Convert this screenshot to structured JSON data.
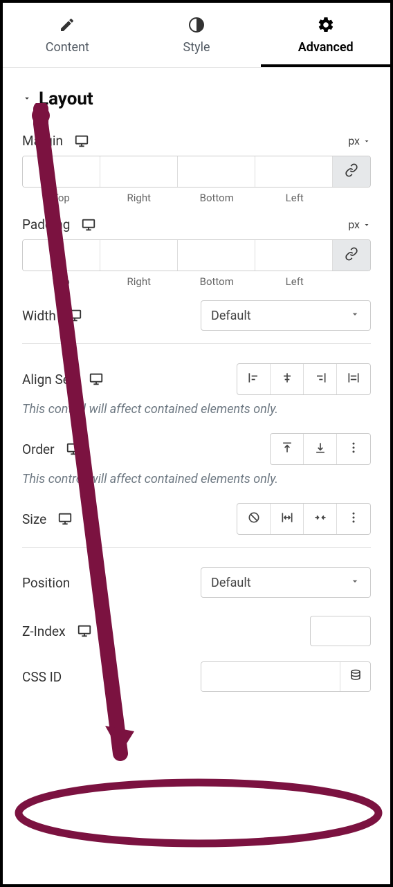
{
  "tabs": {
    "content": "Content",
    "style": "Style",
    "advanced": "Advanced"
  },
  "section": {
    "title": "Layout"
  },
  "margin": {
    "label": "Margin",
    "unit": "px",
    "top": "",
    "right": "",
    "bottom": "",
    "left": "",
    "sub": {
      "top": "Top",
      "right": "Right",
      "bottom": "Bottom",
      "left": "Left"
    }
  },
  "padding": {
    "label": "Padding",
    "unit": "px",
    "top": "",
    "right": "",
    "bottom": "",
    "left": "",
    "sub": {
      "top": "Top",
      "right": "Right",
      "bottom": "Bottom",
      "left": "Left"
    }
  },
  "width": {
    "label": "Width",
    "value": "Default"
  },
  "alignSelf": {
    "label": "Align Self",
    "note": "This control will affect contained elements only."
  },
  "order": {
    "label": "Order",
    "note": "This control will affect contained elements only."
  },
  "size": {
    "label": "Size"
  },
  "position": {
    "label": "Position",
    "value": "Default"
  },
  "zindex": {
    "label": "Z-Index",
    "value": ""
  },
  "cssid": {
    "label": "CSS ID",
    "value": ""
  }
}
